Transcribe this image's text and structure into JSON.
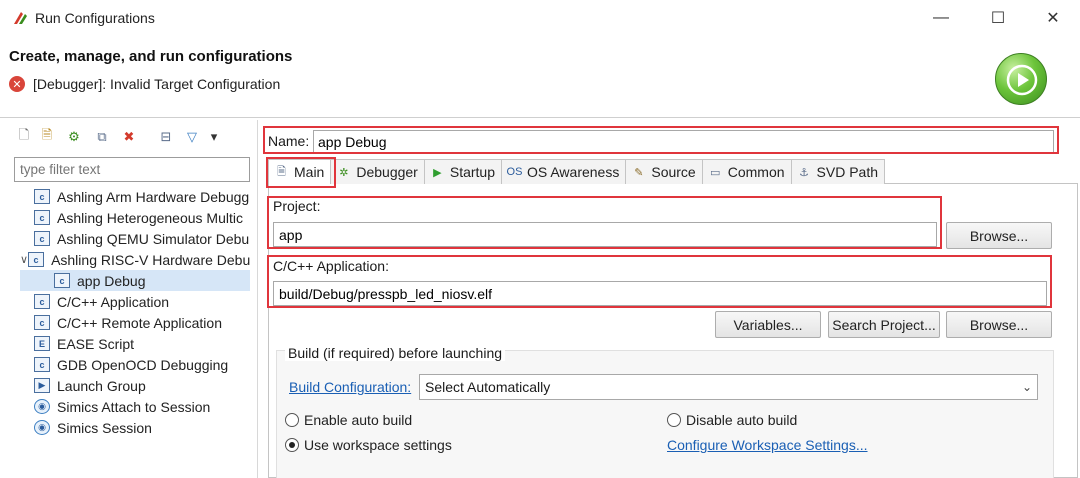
{
  "window": {
    "title": "Run Configurations",
    "min_glyph": "—",
    "max_glyph": "☐",
    "close_glyph": "✕"
  },
  "header": {
    "title": "Create, manage, and run configurations",
    "error_glyph": "✕",
    "error_message": "[Debugger]: Invalid Target Configuration"
  },
  "left": {
    "toolbar": [
      {
        "icon": "new-config-icon",
        "glyph": "🗋"
      },
      {
        "icon": "new-prototype-icon",
        "glyph": "🗎"
      },
      {
        "icon": "export-icon",
        "glyph": "⚙"
      },
      {
        "icon": "duplicate-icon",
        "glyph": "⧉"
      },
      {
        "icon": "delete-icon",
        "glyph": "✖"
      },
      {
        "icon": "collapse-all-icon",
        "glyph": "⊟"
      },
      {
        "icon": "filter-icon",
        "glyph": "▽"
      },
      {
        "icon": "view-menu-icon",
        "glyph": "▾"
      }
    ],
    "filter_placeholder": "type filter text",
    "tree": [
      {
        "label": "Ashling Arm Hardware Debugg",
        "icon_glyph": "c",
        "indent": 0,
        "expander": ""
      },
      {
        "label": "Ashling Heterogeneous Multic",
        "icon_glyph": "c",
        "indent": 0,
        "expander": ""
      },
      {
        "label": "Ashling QEMU Simulator Debu",
        "icon_glyph": "c",
        "indent": 0,
        "expander": ""
      },
      {
        "label": "Ashling RISC-V Hardware Debu",
        "icon_glyph": "c",
        "indent": 0,
        "expander": "∨"
      },
      {
        "label": "app Debug",
        "icon_glyph": "c",
        "indent": 1,
        "expander": "",
        "selected": true
      },
      {
        "label": "C/C++ Application",
        "icon_glyph": "c",
        "indent": 0,
        "expander": ""
      },
      {
        "label": "C/C++ Remote Application",
        "icon_glyph": "c",
        "indent": 0,
        "expander": ""
      },
      {
        "label": "EASE Script",
        "icon_glyph": "E",
        "indent": 0,
        "expander": ""
      },
      {
        "label": "GDB OpenOCD Debugging",
        "icon_glyph": "c",
        "indent": 0,
        "expander": ""
      },
      {
        "label": "Launch Group",
        "icon_glyph": "▶",
        "indent": 0,
        "expander": ""
      },
      {
        "label": "Simics Attach to Session",
        "icon_glyph": "◉",
        "indent": 0,
        "expander": "",
        "round": true
      },
      {
        "label": "Simics Session",
        "icon_glyph": "◉",
        "indent": 0,
        "expander": "",
        "round": true
      }
    ]
  },
  "form": {
    "name_label": "Name:",
    "name_value": "app Debug",
    "tabs": [
      {
        "label": "Main",
        "icon": "main-tab-icon",
        "glyph": "🗎",
        "color": "#5a6c8a"
      },
      {
        "label": "Debugger",
        "icon": "debugger-tab-icon",
        "glyph": "✲",
        "color": "#3a8d1e"
      },
      {
        "label": "Startup",
        "icon": "startup-tab-icon",
        "glyph": "▶",
        "color": "#2f9e2f"
      },
      {
        "label": "OS Awareness",
        "icon": "os-awareness-tab-icon",
        "glyph": "OS",
        "color": "#2b5c9c"
      },
      {
        "label": "Source",
        "icon": "source-tab-icon",
        "glyph": "✎",
        "color": "#8a6c2a"
      },
      {
        "label": "Common",
        "icon": "common-tab-icon",
        "glyph": "▭",
        "color": "#5a6c8a"
      },
      {
        "label": "SVD Path",
        "icon": "svd-path-tab-icon",
        "glyph": "⚓",
        "color": "#5a6c8a"
      }
    ],
    "project_label": "Project:",
    "project_value": "app",
    "browse_label": "Browse...",
    "app_label": "C/C++ Application:",
    "app_value": "build/Debug/presspb_led_niosv.elf",
    "variables_label": "Variables...",
    "search_project_label": "Search Project...",
    "browse_app_label": "Browse..."
  },
  "build": {
    "group_label": "Build (if required) before launching",
    "config_link": "Build Configuration:",
    "config_value": "Select Automatically",
    "enable_auto_build": "Enable auto build",
    "disable_auto_build": "Disable auto build",
    "use_workspace": "Use workspace settings",
    "configure_link": "Configure Workspace Settings...",
    "selected_option": "use_workspace"
  },
  "colors": {
    "highlight": "#e0353c",
    "link": "#1a5fb4",
    "run_green": "#6cc43a"
  }
}
